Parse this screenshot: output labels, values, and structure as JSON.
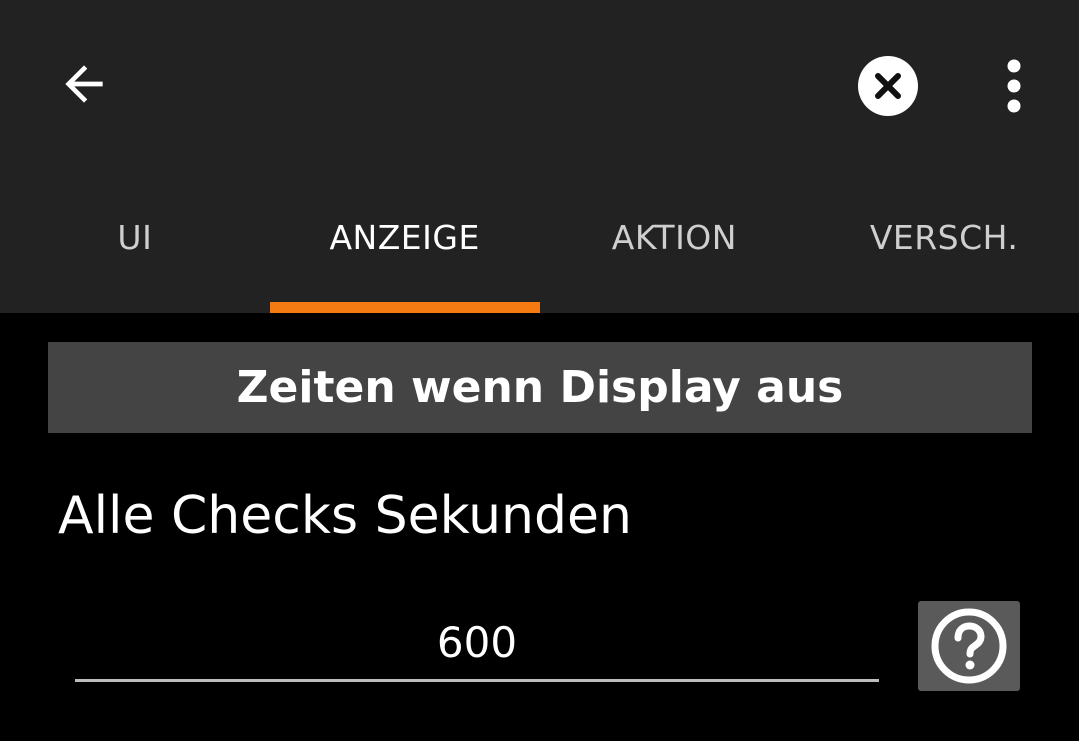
{
  "toolbar": {
    "back_icon": "arrow-left-icon",
    "close_icon": "close-circle-icon",
    "more_icon": "more-vertical-icon"
  },
  "tabs": [
    {
      "label": "UI",
      "active": false
    },
    {
      "label": "ANZEIGE",
      "active": true
    },
    {
      "label": "AKTION",
      "active": false
    },
    {
      "label": "VERSCH.",
      "active": false
    }
  ],
  "section": {
    "title": "Zeiten wenn Display aus"
  },
  "field": {
    "label": "Alle Checks Sekunden",
    "value": "600"
  },
  "help": {
    "icon": "help-circle-icon"
  },
  "colors": {
    "appbar_bg": "#222222",
    "accent": "#f47a12",
    "section_bg": "#444444",
    "help_bg": "#5a5a5a",
    "background": "#000000"
  }
}
